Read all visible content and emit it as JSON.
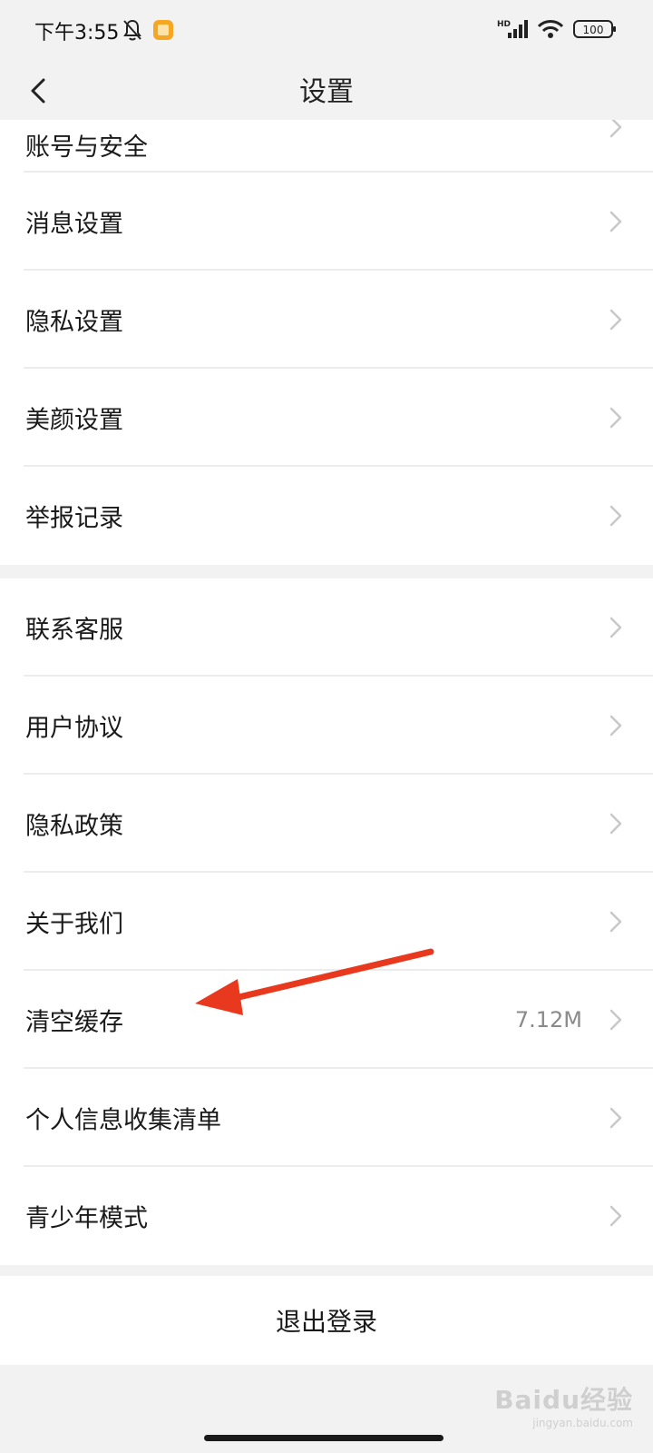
{
  "status_bar": {
    "time": "下午3:55",
    "icons": [
      "bell-off-icon",
      "app-notification-icon",
      "hd-signal-icon",
      "wifi-icon",
      "battery-icon"
    ],
    "network": "HD",
    "battery": "100"
  },
  "header": {
    "title": "设置",
    "back_icon": "chevron-left-icon"
  },
  "group1": {
    "partial_item": "账号与安全",
    "items": [
      {
        "label": "消息设置"
      },
      {
        "label": "隐私设置"
      },
      {
        "label": "美颜设置"
      },
      {
        "label": "举报记录"
      }
    ]
  },
  "group2": {
    "items": [
      {
        "label": "联系客服",
        "value": ""
      },
      {
        "label": "用户协议",
        "value": ""
      },
      {
        "label": "隐私政策",
        "value": ""
      },
      {
        "label": "关于我们",
        "value": ""
      },
      {
        "label": "清空缓存",
        "value": "7.12M"
      },
      {
        "label": "个人信息收集清单",
        "value": ""
      },
      {
        "label": "青少年模式",
        "value": ""
      }
    ]
  },
  "logout": {
    "label": "退出登录"
  },
  "annotation": {
    "arrow_color": "#e8391f",
    "target": "清空缓存"
  },
  "watermark": {
    "main": "Baidu经验",
    "sub": "jingyan.baidu.com"
  },
  "colors": {
    "background": "#f2f2f2",
    "card": "#ffffff",
    "divider": "#ececec",
    "secondary_text": "#8a8a8a"
  }
}
